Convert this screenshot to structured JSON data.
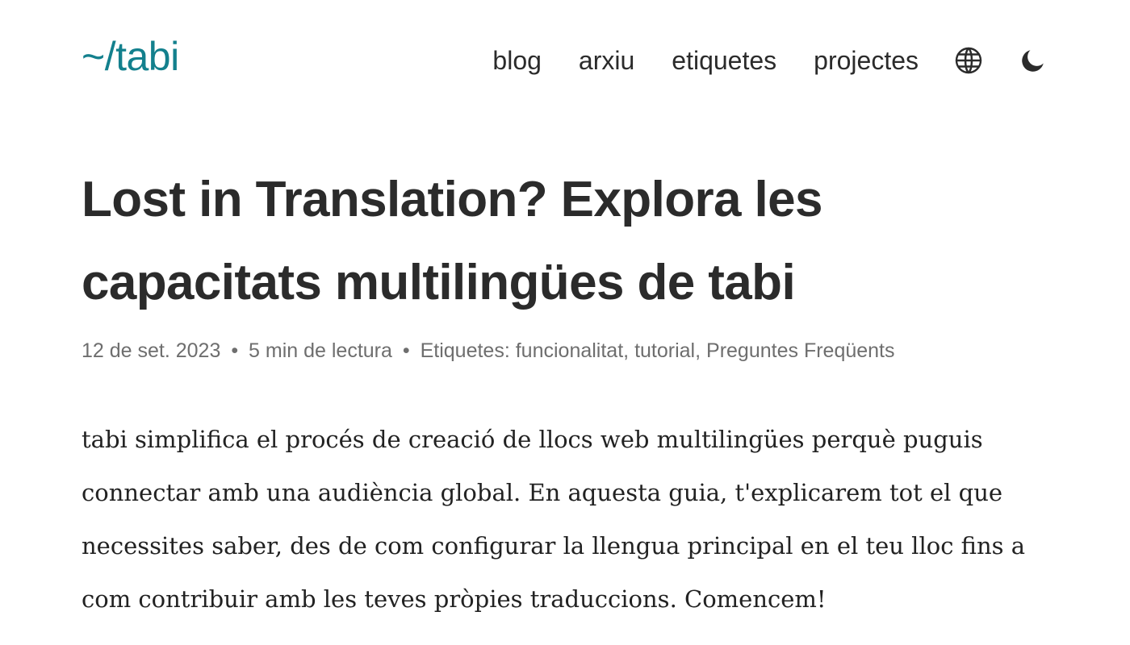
{
  "header": {
    "logo": "~/tabi",
    "nav": [
      "blog",
      "arxiu",
      "etiquetes",
      "projectes"
    ],
    "icons": {
      "language": "globe-icon",
      "theme": "moon-icon"
    }
  },
  "post": {
    "title": "Lost in Translation? Explora les capacitats multilingües de tabi",
    "date": "12 de set. 2023",
    "separator": "•",
    "reading_time": "5 min de lectura",
    "tags_label": "Etiquetes:",
    "tags": [
      "funcionalitat",
      "tutorial",
      "Preguntes Freqüents"
    ],
    "intro": "tabi simplifica el procés de creació de llocs web multilingües perquè puguis connectar amb una audiència global. En aquesta guia, t'explicarem tot el que necessites saber, des de com configurar la llengua principal en el teu lloc fins a com contribuir amb les teves pròpies traduccions. Comencem!"
  },
  "colors": {
    "accent": "#13808d",
    "text": "#2b2b2b",
    "meta": "#6e6e6e"
  }
}
